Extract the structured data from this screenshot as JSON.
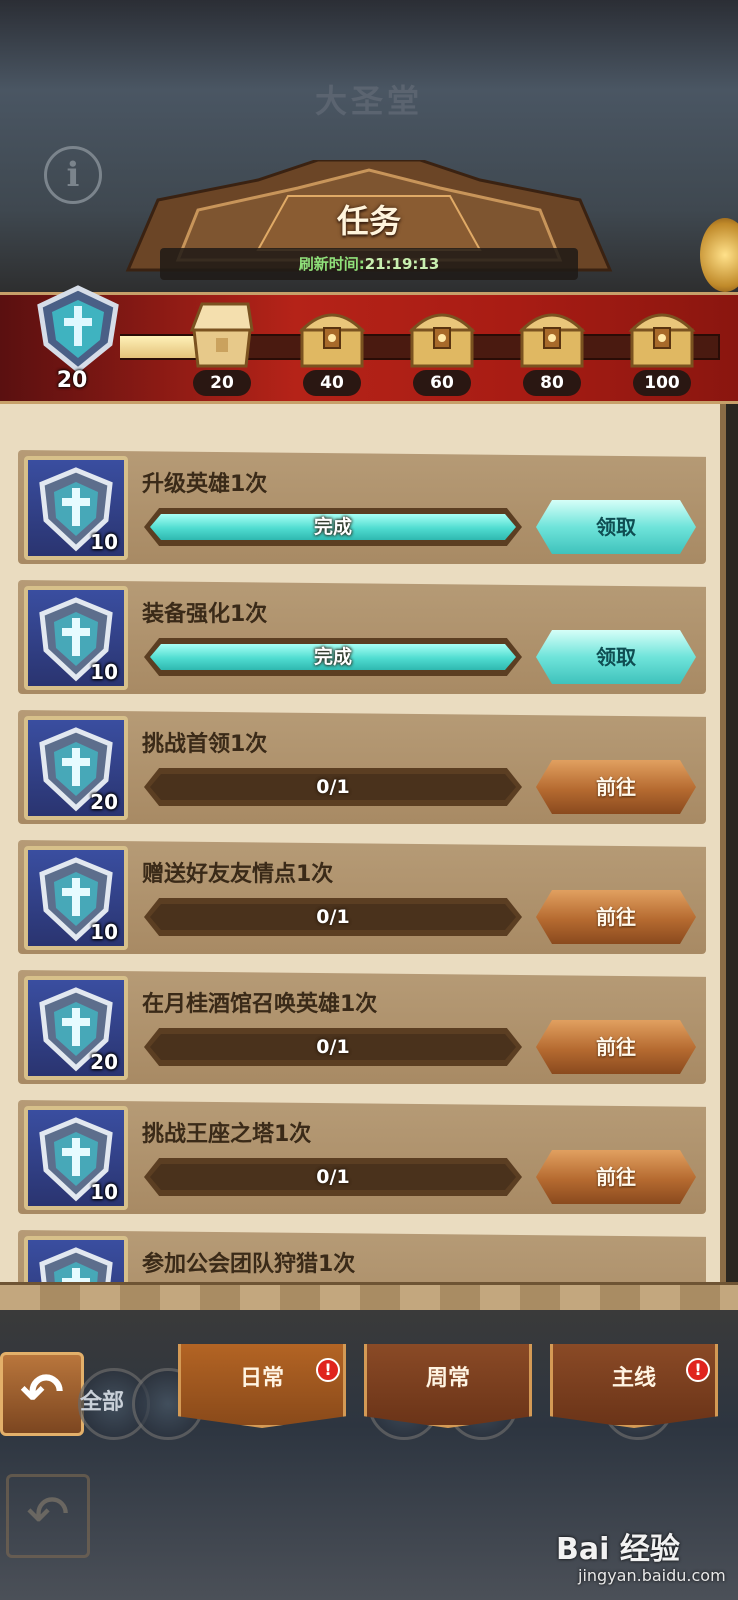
{
  "header": {
    "hall_title": "大圣堂",
    "info_icon": "info-icon",
    "panel_title": "任务",
    "refresh_label": "刷新时间:",
    "refresh_value": "21:19:13"
  },
  "chest_track": {
    "current_points": "20",
    "progress_fraction": 0.2,
    "chests": [
      {
        "points": "20",
        "state": "opened"
      },
      {
        "points": "40",
        "state": "closed"
      },
      {
        "points": "60",
        "state": "closed"
      },
      {
        "points": "80",
        "state": "closed"
      },
      {
        "points": "100",
        "state": "closed"
      }
    ]
  },
  "tasks": [
    {
      "name": "升级英雄1次",
      "points": "10",
      "progress_text": "完成",
      "done": true,
      "button": "领取"
    },
    {
      "name": "装备强化1次",
      "points": "10",
      "progress_text": "完成",
      "done": true,
      "button": "领取"
    },
    {
      "name": "挑战首领1次",
      "points": "20",
      "progress_text": "0/1",
      "done": false,
      "button": "前往"
    },
    {
      "name": "赠送好友友情点1次",
      "points": "10",
      "progress_text": "0/1",
      "done": false,
      "button": "前往"
    },
    {
      "name": "在月桂酒馆召唤英雄1次",
      "points": "20",
      "progress_text": "0/1",
      "done": false,
      "button": "前往"
    },
    {
      "name": "挑战王座之塔1次",
      "points": "10",
      "progress_text": "0/1",
      "done": false,
      "button": "前往"
    },
    {
      "name": "参加公会团队狩猎1次",
      "points": "",
      "progress_text": "",
      "done": false,
      "button": ""
    }
  ],
  "bottom_nav": {
    "back_icon": "back-arrow-icon",
    "filter_label": "全部",
    "tabs": [
      {
        "label": "日常",
        "active": true,
        "badge": "!"
      },
      {
        "label": "周常",
        "active": false,
        "badge": ""
      },
      {
        "label": "主线",
        "active": false,
        "badge": "!"
      }
    ]
  },
  "watermark": {
    "brand": "Bai 经验",
    "url": "jingyan.baidu.com"
  },
  "colors": {
    "complete_fill": "#4fdcd0",
    "claim_button": "#6fe4da",
    "go_button": "#b56a30",
    "badge_red": "#e0241e",
    "strip_red": "#b52318"
  }
}
